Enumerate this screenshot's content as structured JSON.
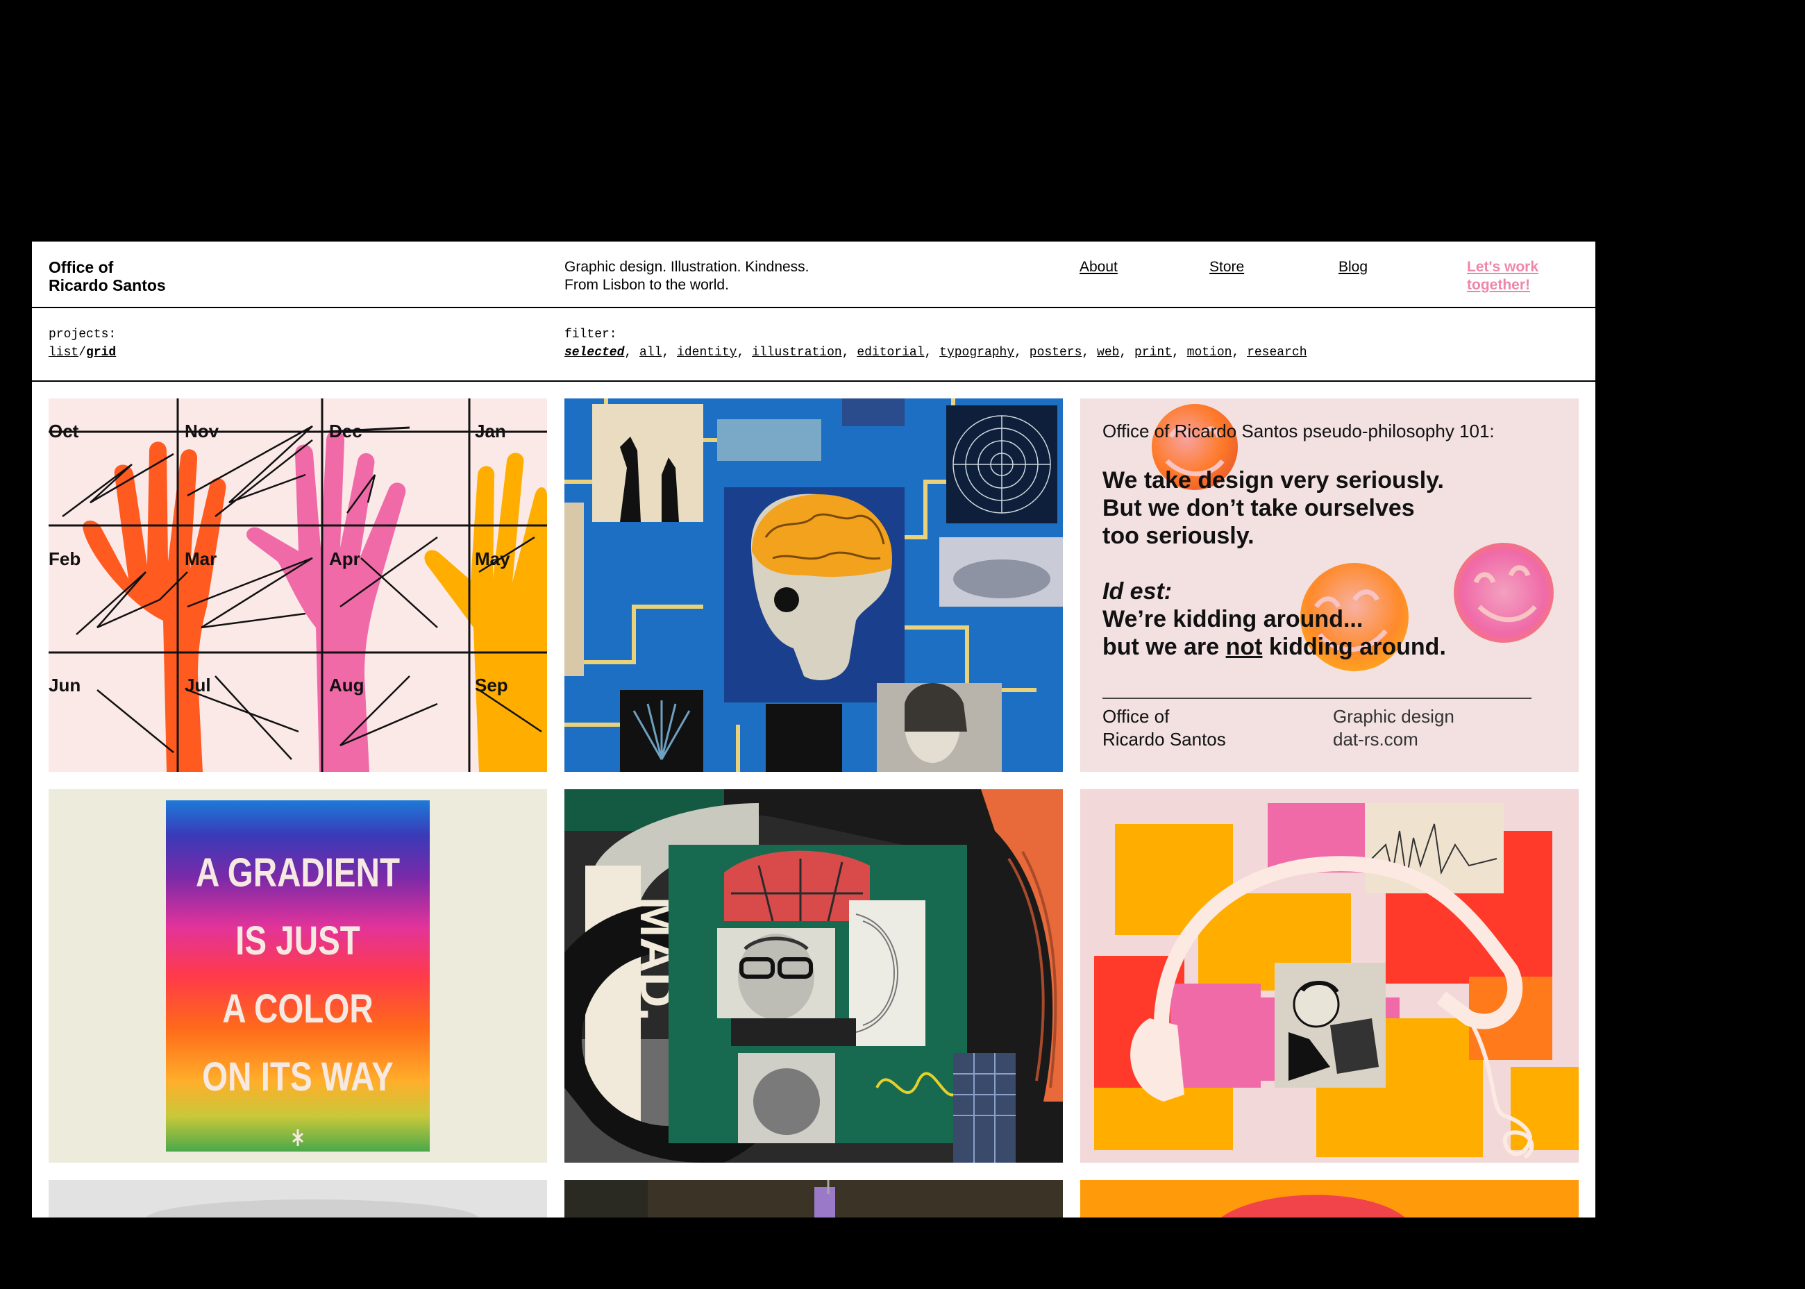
{
  "header": {
    "brand_line1": "Office of",
    "brand_line2": "Ricardo Santos",
    "tagline_line1": "Graphic design. Illustration. Kindness.",
    "tagline_line2": "From Lisbon to the world.",
    "nav": [
      {
        "label": "About"
      },
      {
        "label": "Store"
      },
      {
        "label": "Blog"
      }
    ],
    "cta_line1": "Let's work",
    "cta_line2": "together!"
  },
  "toolbar": {
    "projects_label": "projects:",
    "view_list": "list",
    "view_sep": "/",
    "view_grid": "grid",
    "filter_label": "filter:",
    "filters": [
      "selected",
      "all",
      "identity",
      "illustration",
      "editorial",
      "typography",
      "posters",
      "web",
      "print",
      "motion",
      "research"
    ]
  },
  "tiles": {
    "calendar": {
      "months": [
        "Oct",
        "Nov",
        "Dec",
        "Jan",
        "Feb",
        "Mar",
        "Apr",
        "May",
        "Jun",
        "Jul",
        "Aug",
        "Sep"
      ]
    },
    "philosophy": {
      "heading": "Office of Ricardo Santos pseudo-philosophy 101:",
      "line1": "We take design very seriously.",
      "line2": "But we don’t take ourselves",
      "line3": "too seriously.",
      "idest": "Id est:",
      "line4": "We’re kidding around...",
      "line5_a": "but we are ",
      "line5_not": "not",
      "line5_b": " kidding around.",
      "footer_left1": "Office of",
      "footer_left2": "Ricardo Santos",
      "footer_right1": "Graphic design",
      "footer_right2": "dat-rs.com"
    },
    "gradient_poster": {
      "lines": [
        "A GRADIENT",
        "IS JUST",
        "A COLOR",
        "ON ITS WAY"
      ]
    },
    "mad_collage": {
      "text": "MAD."
    }
  },
  "colors": {
    "accent": "#ef86a8",
    "orange": "#ff5a1f",
    "pink": "#f06aa8",
    "yellow": "#ffae00",
    "blue": "#1d6fc4"
  }
}
